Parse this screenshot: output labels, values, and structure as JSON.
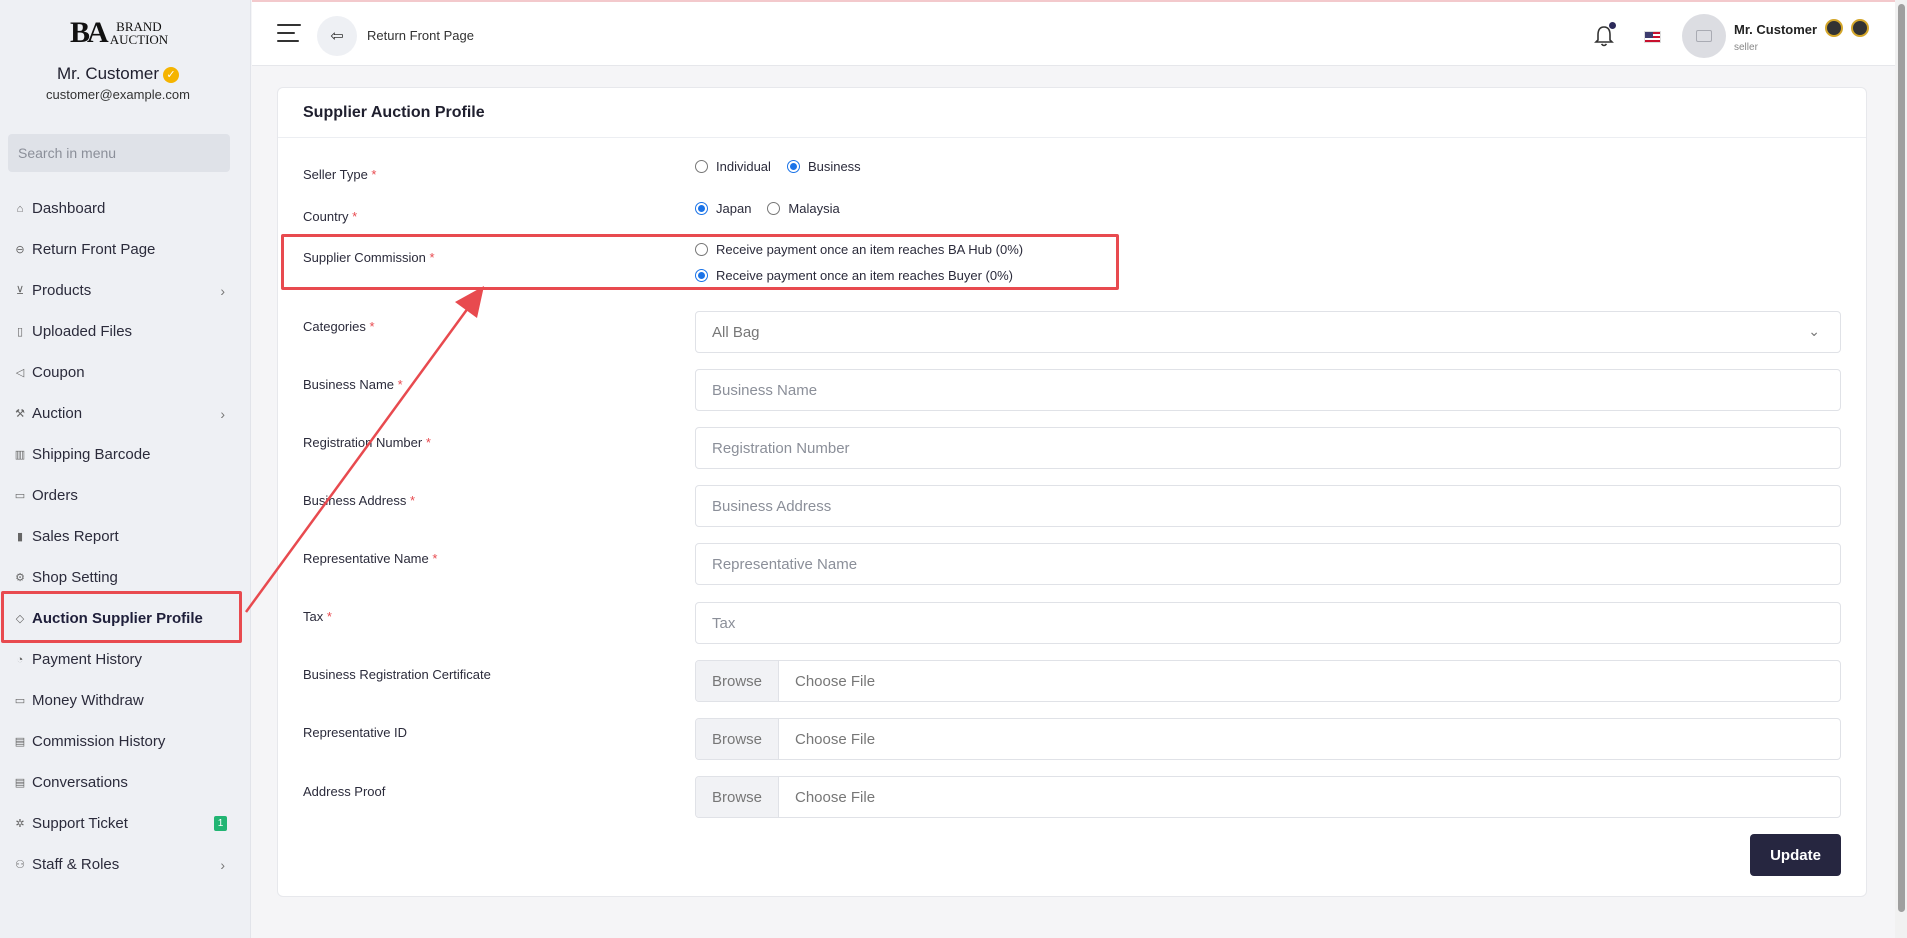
{
  "brand": {
    "mark": "BA",
    "line1": "BRAND",
    "line2": "AUCTION"
  },
  "user": {
    "name": "Mr. Customer",
    "email": "customer@example.com",
    "role": "seller"
  },
  "sidebar": {
    "search_placeholder": "Search in menu",
    "items": [
      {
        "label": "Dashboard",
        "icon": "home-icon"
      },
      {
        "label": "Return Front Page",
        "icon": "back-icon"
      },
      {
        "label": "Products",
        "icon": "cart-icon",
        "has_submenu": true
      },
      {
        "label": "Uploaded Files",
        "icon": "file-icon"
      },
      {
        "label": "Coupon",
        "icon": "megaphone-icon"
      },
      {
        "label": "Auction",
        "icon": "gavel-icon",
        "has_submenu": true
      },
      {
        "label": "Shipping Barcode",
        "icon": "barcode-icon"
      },
      {
        "label": "Orders",
        "icon": "orders-icon"
      },
      {
        "label": "Sales Report",
        "icon": "chart-icon"
      },
      {
        "label": "Shop Setting",
        "icon": "gear-icon"
      },
      {
        "label": "Auction Supplier Profile",
        "icon": "handshake-icon",
        "active": true
      },
      {
        "label": "Payment History",
        "icon": "history-icon"
      },
      {
        "label": "Money Withdraw",
        "icon": "wallet-icon"
      },
      {
        "label": "Commission History",
        "icon": "document-icon"
      },
      {
        "label": "Conversations",
        "icon": "chat-icon"
      },
      {
        "label": "Support Ticket",
        "icon": "support-icon",
        "badge": "1"
      },
      {
        "label": "Staff & Roles",
        "icon": "users-icon",
        "has_submenu": true
      }
    ]
  },
  "topbar": {
    "back_label": "Return Front Page"
  },
  "form": {
    "title": "Supplier Auction Profile",
    "seller_type": {
      "label": "Seller Type",
      "options": [
        "Individual",
        "Business"
      ],
      "selected": "Business"
    },
    "country": {
      "label": "Country",
      "options": [
        "Japan",
        "Malaysia"
      ],
      "selected": "Japan"
    },
    "commission": {
      "label": "Supplier Commission",
      "options": [
        "Receive payment once an item reaches BA Hub (0%)",
        "Receive payment once an item reaches Buyer (0%)"
      ],
      "selected": "Receive payment once an item reaches Buyer (0%)"
    },
    "categories": {
      "label": "Categories",
      "value": "All Bag"
    },
    "business_name": {
      "label": "Business Name",
      "placeholder": "Business Name"
    },
    "registration_number": {
      "label": "Registration Number",
      "placeholder": "Registration Number"
    },
    "business_address": {
      "label": "Business Address",
      "placeholder": "Business Address"
    },
    "representative_name": {
      "label": "Representative Name",
      "placeholder": "Representative Name"
    },
    "tax": {
      "label": "Tax",
      "placeholder": "Tax"
    },
    "brc": {
      "label": "Business Registration Certificate",
      "browse": "Browse",
      "choose": "Choose File"
    },
    "rep_id": {
      "label": "Representative ID",
      "browse": "Browse",
      "choose": "Choose File"
    },
    "address_proof": {
      "label": "Address Proof",
      "browse": "Browse",
      "choose": "Choose File"
    },
    "required_mark": "*",
    "update_label": "Update"
  },
  "colors": {
    "annotation": "#e84a4f",
    "primary_button": "#262640",
    "radio_accent": "#1a73e8",
    "badge": "#22b573"
  }
}
